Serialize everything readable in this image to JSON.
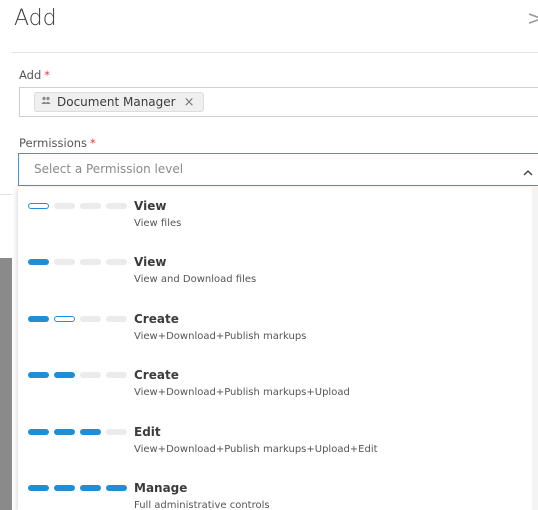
{
  "dialog": {
    "title": "Add",
    "close_glyph": ">"
  },
  "add_field": {
    "label": "Add",
    "required_mark": "*",
    "chip_label": "Document Manager",
    "chip_icon": "group-icon",
    "chip_close": "×"
  },
  "permissions": {
    "label": "Permissions",
    "required_mark": "*",
    "placeholder": "Select a Permission level",
    "expanded": true,
    "options": [
      {
        "title": "View",
        "desc": "View files",
        "level": "half-1",
        "bars": [
          "half",
          "empty",
          "empty",
          "empty"
        ]
      },
      {
        "title": "View",
        "desc": "View and Download files",
        "level": "1",
        "bars": [
          "full",
          "empty",
          "empty",
          "empty"
        ]
      },
      {
        "title": "Create",
        "desc": "View+Download+Publish markups",
        "level": "1.5",
        "bars": [
          "full",
          "half",
          "empty",
          "empty"
        ]
      },
      {
        "title": "Create",
        "desc": "View+Download+Publish markups+Upload",
        "level": "2",
        "bars": [
          "full",
          "full",
          "empty",
          "empty"
        ]
      },
      {
        "title": "Edit",
        "desc": "View+Download+Publish markups+Upload+Edit",
        "level": "3",
        "bars": [
          "full",
          "full",
          "full",
          "empty"
        ]
      },
      {
        "title": "Manage",
        "desc": "Full administrative controls",
        "level": "4",
        "bars": [
          "full",
          "full",
          "full",
          "full"
        ]
      }
    ]
  },
  "colors": {
    "accent": "#1f8ed6",
    "focus_border": "#3b9bd8",
    "required": "#e03a3a"
  }
}
